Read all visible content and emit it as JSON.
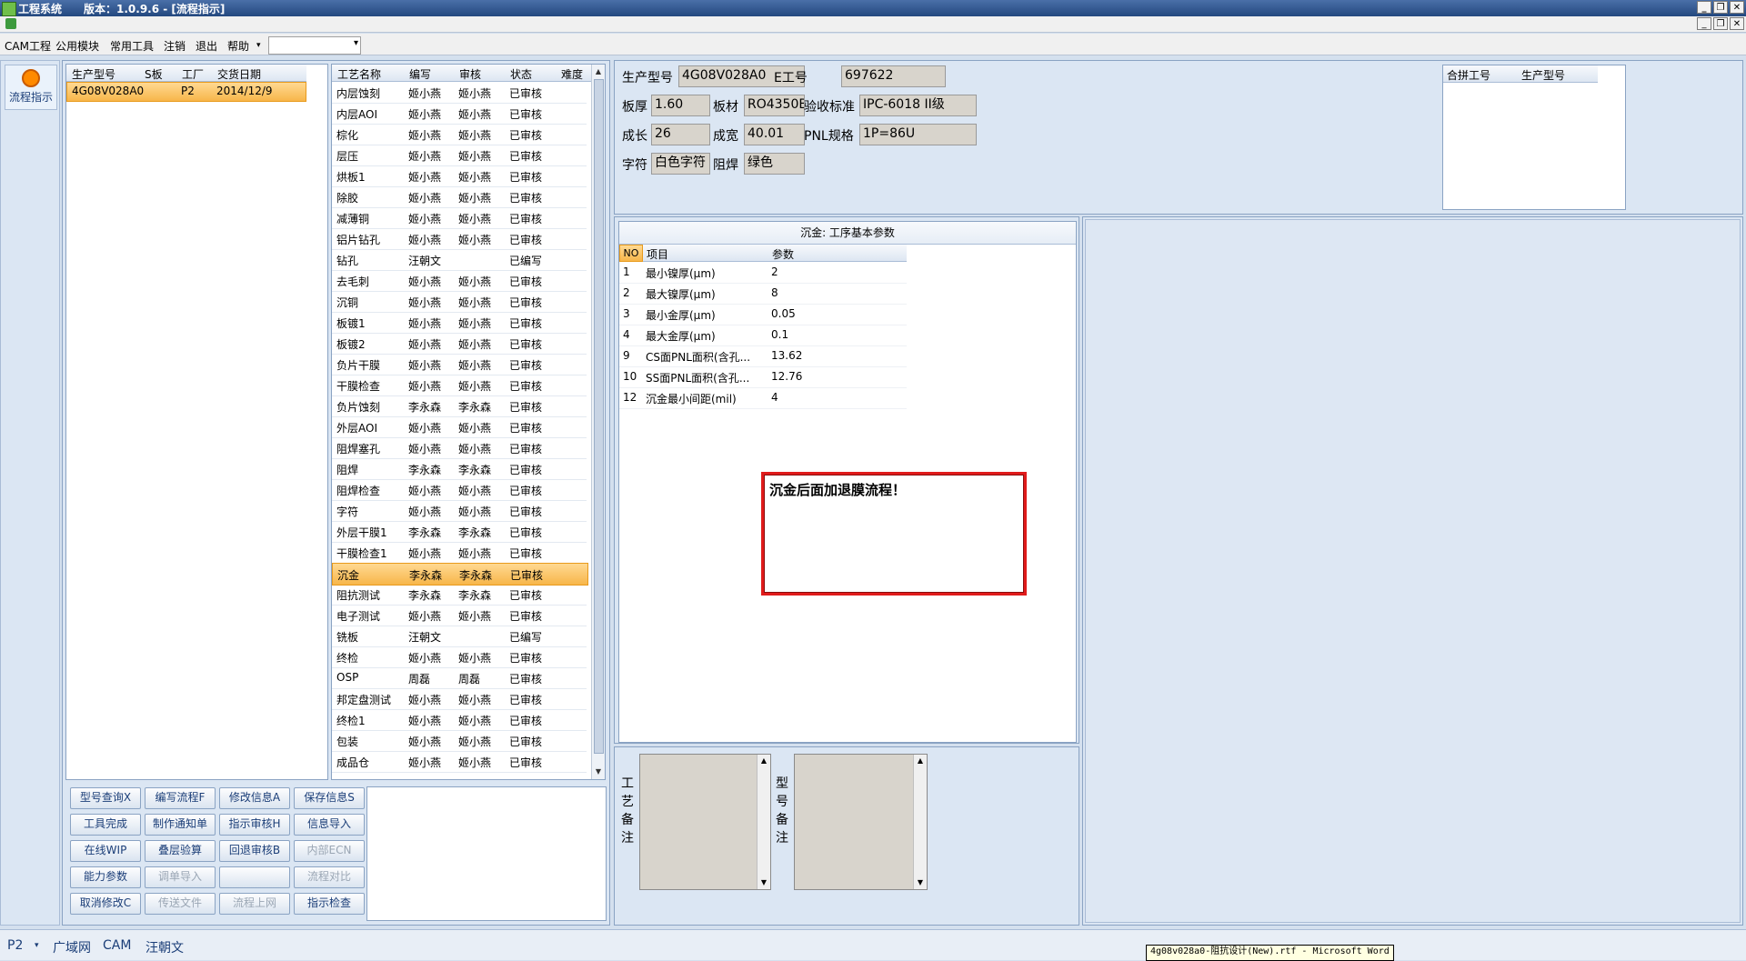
{
  "window": {
    "app_title": "工程系统",
    "version_text": "版本：1.0.9.6 - [流程指示]",
    "min": "_",
    "restore": "❐",
    "close": "✕"
  },
  "menu": [
    "CAM工程",
    "公用模块",
    "常用工具",
    "注销",
    "退出",
    "帮助"
  ],
  "left_nav": {
    "flow_label": "流程指示"
  },
  "job_grid": {
    "headers": [
      "生产型号",
      "S板",
      "工厂",
      "交货日期"
    ],
    "rows": [
      {
        "model": "4G08V028A0",
        "s": "",
        "factory": "P2",
        "date": "2014/12/9"
      }
    ]
  },
  "process_grid": {
    "headers": [
      "工艺名称",
      "编写",
      "审核",
      "状态",
      "难度"
    ],
    "rows": [
      [
        "内层蚀刻",
        "姬小燕",
        "姬小燕",
        "已审核"
      ],
      [
        "内层AOI",
        "姬小燕",
        "姬小燕",
        "已审核"
      ],
      [
        "棕化",
        "姬小燕",
        "姬小燕",
        "已审核"
      ],
      [
        "层压",
        "姬小燕",
        "姬小燕",
        "已审核"
      ],
      [
        "烘板1",
        "姬小燕",
        "姬小燕",
        "已审核"
      ],
      [
        "除胶",
        "姬小燕",
        "姬小燕",
        "已审核"
      ],
      [
        "减薄铜",
        "姬小燕",
        "姬小燕",
        "已审核"
      ],
      [
        "铝片钻孔",
        "姬小燕",
        "姬小燕",
        "已审核"
      ],
      [
        "钻孔",
        "汪朝文",
        "",
        "已编写"
      ],
      [
        "去毛刺",
        "姬小燕",
        "姬小燕",
        "已审核"
      ],
      [
        "沉铜",
        "姬小燕",
        "姬小燕",
        "已审核"
      ],
      [
        "板镀1",
        "姬小燕",
        "姬小燕",
        "已审核"
      ],
      [
        "板镀2",
        "姬小燕",
        "姬小燕",
        "已审核"
      ],
      [
        "负片干膜",
        "姬小燕",
        "姬小燕",
        "已审核"
      ],
      [
        "干膜检查",
        "姬小燕",
        "姬小燕",
        "已审核"
      ],
      [
        "负片蚀刻",
        "李永森",
        "李永森",
        "已审核"
      ],
      [
        "外层AOI",
        "姬小燕",
        "姬小燕",
        "已审核"
      ],
      [
        "阻焊塞孔",
        "姬小燕",
        "姬小燕",
        "已审核"
      ],
      [
        "阻焊",
        "李永森",
        "李永森",
        "已审核"
      ],
      [
        "阻焊检查",
        "姬小燕",
        "姬小燕",
        "已审核"
      ],
      [
        "字符",
        "姬小燕",
        "姬小燕",
        "已审核"
      ],
      [
        "外层干膜1",
        "李永森",
        "李永森",
        "已审核"
      ],
      [
        "干膜检查1",
        "姬小燕",
        "姬小燕",
        "已审核"
      ],
      [
        "沉金",
        "李永森",
        "李永森",
        "已审核"
      ],
      [
        "阻抗测试",
        "李永森",
        "李永森",
        "已审核"
      ],
      [
        "电子测试",
        "姬小燕",
        "姬小燕",
        "已审核"
      ],
      [
        "铣板",
        "汪朝文",
        "",
        "已编写"
      ],
      [
        "终检",
        "姬小燕",
        "姬小燕",
        "已审核"
      ],
      [
        "OSP",
        "周磊",
        "周磊",
        "已审核"
      ],
      [
        "邦定盘测试",
        "姬小燕",
        "姬小燕",
        "已审核"
      ],
      [
        "终检1",
        "姬小燕",
        "姬小燕",
        "已审核"
      ],
      [
        "包装",
        "姬小燕",
        "姬小燕",
        "已审核"
      ],
      [
        "成品仓",
        "姬小燕",
        "姬小燕",
        "已审核"
      ]
    ],
    "selected_index": 23
  },
  "buttons": [
    [
      "型号查询X",
      "编写流程F",
      "修改信息A",
      "保存信息S"
    ],
    [
      "工具完成",
      "制作通知单",
      "指示审核H",
      "信息导入"
    ],
    [
      "在线WIP",
      "叠层验算",
      "回退审核B",
      "内部ECN"
    ],
    [
      "能力参数",
      "调单导入",
      "",
      "流程对比"
    ],
    [
      "取消修改C",
      "传送文件",
      "流程上网",
      "指示检查"
    ]
  ],
  "buttons_disabled": [
    "内部ECN",
    "调单导入",
    "流程对比",
    "传送文件",
    "流程上网",
    ""
  ],
  "info": {
    "model_label": "生产型号",
    "model": "4G08V028A0",
    "eno_label": "E工号",
    "eno": "697622",
    "thickness_label": "板厚",
    "thickness": "1.60",
    "material_label": "板材",
    "material": "RO4350B",
    "standard_label": "验收标准",
    "standard": "IPC-6018 II级",
    "length_label": "成长",
    "length": "26",
    "width_label": "成宽",
    "width": "40.01",
    "pnl_label": "PNL规格",
    "pnl": "1P=86U",
    "silk_label": "字符",
    "silk": "白色字符",
    "mask_label": "阻焊",
    "mask": "绿色"
  },
  "merge_grid": {
    "headers": [
      "合拼工号",
      "生产型号"
    ]
  },
  "params": {
    "title": "沉金: 工序基本参数",
    "headers": [
      "NO",
      "项目",
      "参数"
    ],
    "rows": [
      [
        "1",
        "最小镍厚(μm)",
        "2"
      ],
      [
        "2",
        "最大镍厚(μm)",
        "8"
      ],
      [
        "3",
        "最小金厚(μm)",
        "0.05"
      ],
      [
        "4",
        "最大金厚(μm)",
        "0.1"
      ],
      [
        "9",
        "CS面PNL面积(含孔...",
        "13.62"
      ],
      [
        "10",
        "SS面PNL面积(含孔...",
        "12.76"
      ],
      [
        "12",
        "沉金最小间距(mil)",
        "4"
      ]
    ]
  },
  "note_text": "沉金后面加退膜流程！",
  "remarks": {
    "process_label": "工艺备注",
    "model_label": "型号备注"
  },
  "status": {
    "site": "P2",
    "network": "广域网",
    "dept": "CAM",
    "user": "汪朝文"
  },
  "tooltip_text": "4g08v028a0-阻抗设计(New).rtf - Microsoft Word",
  "colors": {
    "selection": "#f7b64a",
    "note_border": "#e01b1b",
    "panel": "#dbe6f3"
  }
}
